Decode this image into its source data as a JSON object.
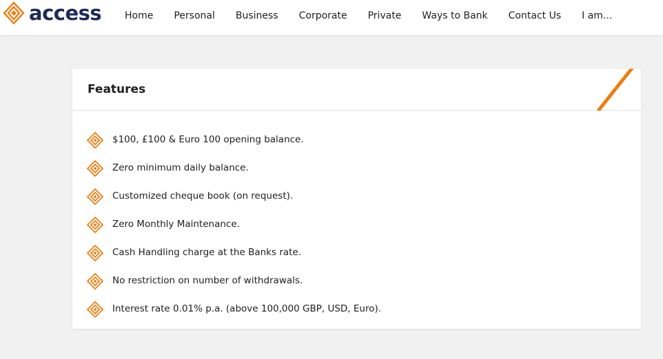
{
  "brand": {
    "name": "access",
    "logo_icon": "access-diamond-logo",
    "colors": {
      "navy": "#1f2a5a",
      "orange": "#ee7d11"
    }
  },
  "nav": {
    "items": [
      "Home",
      "Personal",
      "Business",
      "Corporate",
      "Private",
      "Ways to Bank",
      "Contact Us",
      "I am..."
    ]
  },
  "features_card": {
    "title": "Features",
    "bullet_icon": "orange-diamond-bullet-icon",
    "items": [
      "$100, £100 & Euro 100 opening balance.",
      "Zero minimum daily balance.",
      "Customized cheque book (on request).",
      "Zero Monthly Maintenance.",
      "Cash Handling charge at the Banks rate.",
      "No restriction on number of withdrawals.",
      "Interest rate 0.01% p.a. (above 100,000 GBP, USD, Euro)."
    ]
  }
}
